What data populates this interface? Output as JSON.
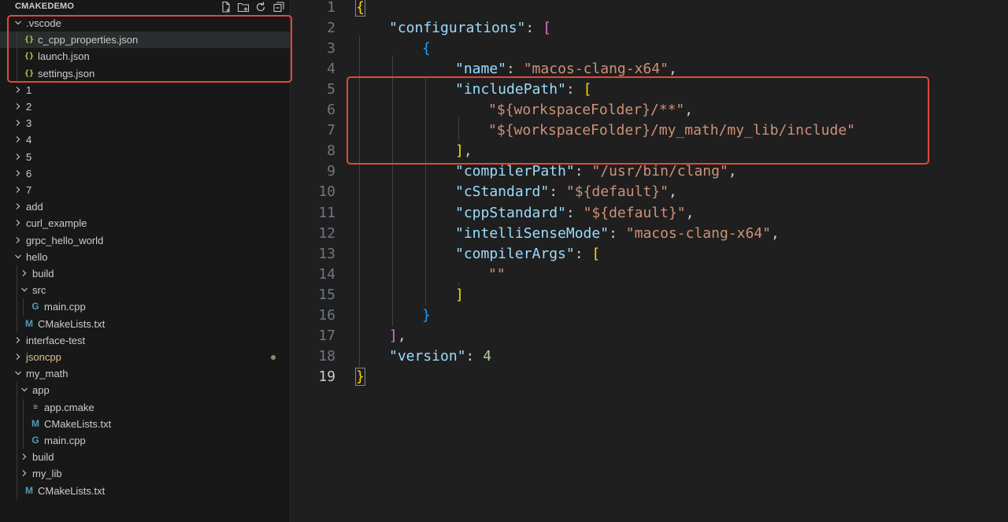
{
  "explorer": {
    "title": "CMAKEDEMO",
    "actions": [
      "new-file",
      "new-folder",
      "refresh",
      "collapse-all"
    ],
    "tree": [
      {
        "label": ".vscode",
        "kind": "folder",
        "expanded": true,
        "depth": 0
      },
      {
        "label": "c_cpp_properties.json",
        "kind": "json",
        "icon": "{}",
        "depth": 1,
        "selected": true
      },
      {
        "label": "launch.json",
        "kind": "json",
        "icon": "{}",
        "depth": 1
      },
      {
        "label": "settings.json",
        "kind": "json",
        "icon": "{}",
        "depth": 1
      },
      {
        "label": "1",
        "kind": "folder",
        "expanded": false,
        "depth": 0
      },
      {
        "label": "2",
        "kind": "folder",
        "expanded": false,
        "depth": 0
      },
      {
        "label": "3",
        "kind": "folder",
        "expanded": false,
        "depth": 0
      },
      {
        "label": "4",
        "kind": "folder",
        "expanded": false,
        "depth": 0
      },
      {
        "label": "5",
        "kind": "folder",
        "expanded": false,
        "depth": 0
      },
      {
        "label": "6",
        "kind": "folder",
        "expanded": false,
        "depth": 0
      },
      {
        "label": "7",
        "kind": "folder",
        "expanded": false,
        "depth": 0
      },
      {
        "label": "add",
        "kind": "folder",
        "expanded": false,
        "depth": 0
      },
      {
        "label": "curl_example",
        "kind": "folder",
        "expanded": false,
        "depth": 0
      },
      {
        "label": "grpc_hello_world",
        "kind": "folder",
        "expanded": false,
        "depth": 0
      },
      {
        "label": "hello",
        "kind": "folder",
        "expanded": true,
        "depth": 0
      },
      {
        "label": "build",
        "kind": "folder",
        "expanded": false,
        "depth": 1
      },
      {
        "label": "src",
        "kind": "folder",
        "expanded": true,
        "depth": 1
      },
      {
        "label": "main.cpp",
        "kind": "cpp",
        "icon": "G",
        "depth": 2
      },
      {
        "label": "CMakeLists.txt",
        "kind": "cmake",
        "icon": "M",
        "depth": 1
      },
      {
        "label": "interface-test",
        "kind": "folder",
        "expanded": false,
        "depth": 0
      },
      {
        "label": "jsoncpp",
        "kind": "folder",
        "expanded": false,
        "depth": 0,
        "modified": true
      },
      {
        "label": "my_math",
        "kind": "folder",
        "expanded": true,
        "depth": 0
      },
      {
        "label": "app",
        "kind": "folder",
        "expanded": true,
        "depth": 1
      },
      {
        "label": "app.cmake",
        "kind": "txt",
        "icon": "≡",
        "depth": 2
      },
      {
        "label": "CMakeLists.txt",
        "kind": "cmake",
        "icon": "M",
        "depth": 2
      },
      {
        "label": "main.cpp",
        "kind": "cpp",
        "icon": "G",
        "depth": 2
      },
      {
        "label": "build",
        "kind": "folder",
        "expanded": false,
        "depth": 1
      },
      {
        "label": "my_lib",
        "kind": "folder",
        "expanded": false,
        "depth": 1
      },
      {
        "label": "CMakeLists.txt",
        "kind": "cmake",
        "icon": "M",
        "depth": 1
      }
    ]
  },
  "editor": {
    "active_line": 19,
    "lines": [
      {
        "n": 1,
        "indent": 0,
        "tokens": [
          {
            "t": "{",
            "c": "b1 bm"
          }
        ]
      },
      {
        "n": 2,
        "indent": 1,
        "tokens": [
          {
            "t": "\"configurations\"",
            "c": "k"
          },
          {
            "t": ": ",
            "c": "p"
          },
          {
            "t": "[",
            "c": "b2"
          }
        ]
      },
      {
        "n": 3,
        "indent": 2,
        "tokens": [
          {
            "t": "{",
            "c": "b3"
          }
        ]
      },
      {
        "n": 4,
        "indent": 3,
        "tokens": [
          {
            "t": "\"name\"",
            "c": "k"
          },
          {
            "t": ": ",
            "c": "p"
          },
          {
            "t": "\"macos-clang-x64\"",
            "c": "s"
          },
          {
            "t": ",",
            "c": "p"
          }
        ]
      },
      {
        "n": 5,
        "indent": 3,
        "tokens": [
          {
            "t": "\"includePath\"",
            "c": "k"
          },
          {
            "t": ": ",
            "c": "p"
          },
          {
            "t": "[",
            "c": "b1"
          }
        ]
      },
      {
        "n": 6,
        "indent": 4,
        "tokens": [
          {
            "t": "\"${workspaceFolder}/**\"",
            "c": "s"
          },
          {
            "t": ",",
            "c": "p"
          }
        ]
      },
      {
        "n": 7,
        "indent": 4,
        "tokens": [
          {
            "t": "\"${workspaceFolder}/my_math/my_lib/include\"",
            "c": "s"
          }
        ]
      },
      {
        "n": 8,
        "indent": 3,
        "tokens": [
          {
            "t": "]",
            "c": "b1"
          },
          {
            "t": ",",
            "c": "p"
          }
        ]
      },
      {
        "n": 9,
        "indent": 3,
        "tokens": [
          {
            "t": "\"compilerPath\"",
            "c": "k"
          },
          {
            "t": ": ",
            "c": "p"
          },
          {
            "t": "\"/usr/bin/clang\"",
            "c": "s"
          },
          {
            "t": ",",
            "c": "p"
          }
        ]
      },
      {
        "n": 10,
        "indent": 3,
        "tokens": [
          {
            "t": "\"cStandard\"",
            "c": "k"
          },
          {
            "t": ": ",
            "c": "p"
          },
          {
            "t": "\"${default}\"",
            "c": "s"
          },
          {
            "t": ",",
            "c": "p"
          }
        ]
      },
      {
        "n": 11,
        "indent": 3,
        "tokens": [
          {
            "t": "\"cppStandard\"",
            "c": "k"
          },
          {
            "t": ": ",
            "c": "p"
          },
          {
            "t": "\"${default}\"",
            "c": "s"
          },
          {
            "t": ",",
            "c": "p"
          }
        ]
      },
      {
        "n": 12,
        "indent": 3,
        "tokens": [
          {
            "t": "\"intelliSenseMode\"",
            "c": "k"
          },
          {
            "t": ": ",
            "c": "p"
          },
          {
            "t": "\"macos-clang-x64\"",
            "c": "s"
          },
          {
            "t": ",",
            "c": "p"
          }
        ]
      },
      {
        "n": 13,
        "indent": 3,
        "tokens": [
          {
            "t": "\"compilerArgs\"",
            "c": "k"
          },
          {
            "t": ": ",
            "c": "p"
          },
          {
            "t": "[",
            "c": "b1"
          }
        ]
      },
      {
        "n": 14,
        "indent": 4,
        "tokens": [
          {
            "t": "\"\"",
            "c": "s"
          }
        ]
      },
      {
        "n": 15,
        "indent": 3,
        "tokens": [
          {
            "t": "]",
            "c": "b1"
          }
        ]
      },
      {
        "n": 16,
        "indent": 2,
        "tokens": [
          {
            "t": "}",
            "c": "b3"
          }
        ]
      },
      {
        "n": 17,
        "indent": 1,
        "tokens": [
          {
            "t": "]",
            "c": "b2"
          },
          {
            "t": ",",
            "c": "p"
          }
        ]
      },
      {
        "n": 18,
        "indent": 1,
        "tokens": [
          {
            "t": "\"version\"",
            "c": "k"
          },
          {
            "t": ": ",
            "c": "p"
          },
          {
            "t": "4",
            "c": "n"
          }
        ]
      },
      {
        "n": 19,
        "indent": 0,
        "tokens": [
          {
            "t": "}",
            "c": "b1 bm"
          }
        ]
      }
    ]
  },
  "colors": {
    "annotation_box": "#e0493b",
    "key": "#9cdcfe",
    "string": "#ce9178",
    "number": "#b5cea8",
    "bracket_gold": "#ffd700",
    "bracket_pink": "#da70d6",
    "bracket_blue": "#179fff"
  }
}
